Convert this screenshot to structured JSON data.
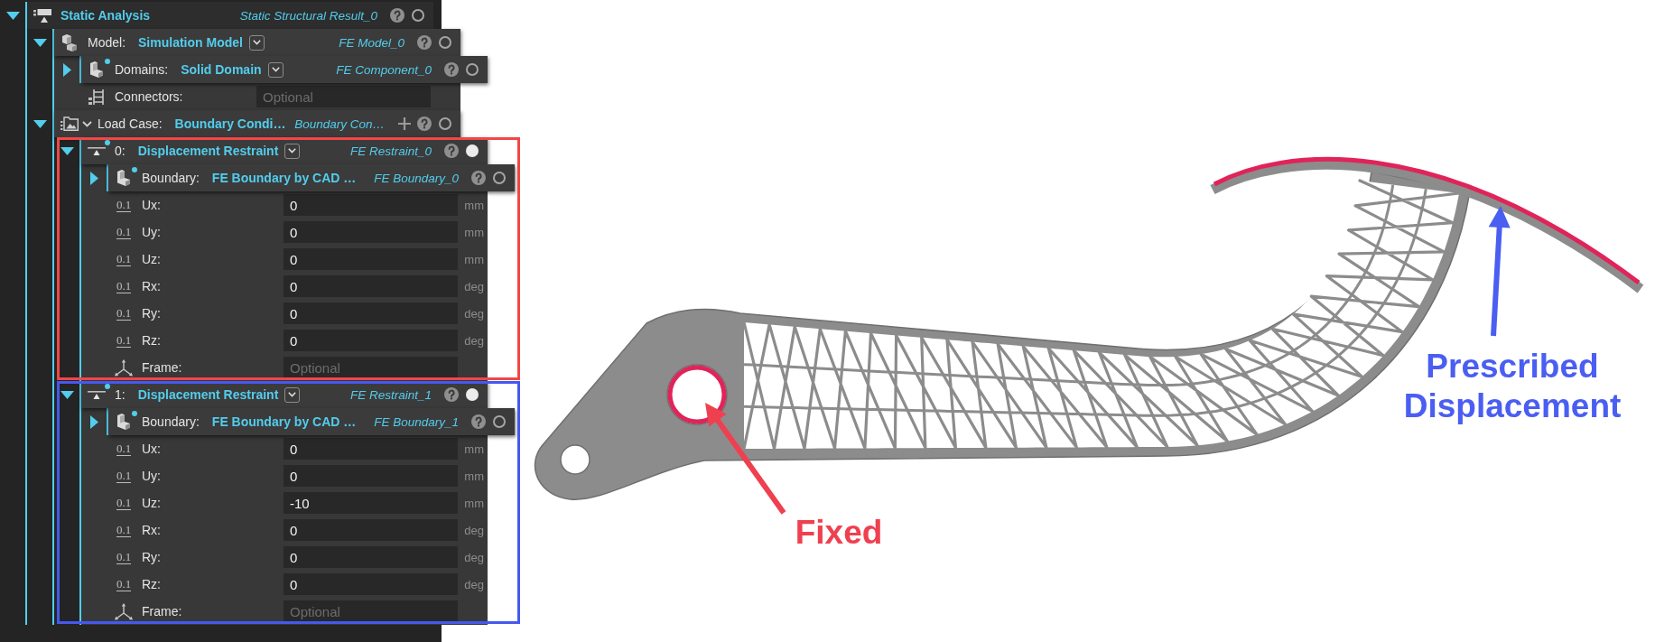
{
  "tree": [
    {
      "kind": "analysis",
      "value": "Static Analysis",
      "dropdown": false,
      "flagged": false,
      "addable": false,
      "type_name": "Static Structural Result_0",
      "expanded": true,
      "active": false,
      "children": [
        {
          "kind": "model",
          "label": "Model:",
          "value": "Simulation Model",
          "dropdown": true,
          "flagged": false,
          "addable": false,
          "type_name": "FE Model_0",
          "expanded": true,
          "active": false,
          "children": [
            {
              "kind": "domain",
              "label": "Domains:",
              "value": "Solid Domain",
              "dropdown": true,
              "flagged": true,
              "addable": false,
              "type_name": "FE Component_0",
              "expanded": false,
              "active": false
            },
            {
              "kind": "connectors",
              "label": "Connectors:",
              "placeholder": "Optional"
            }
          ]
        },
        {
          "kind": "load_case",
          "label": "Load Case:",
          "value": "Boundary Condi…",
          "dropdown": false,
          "flagged": false,
          "addable": true,
          "type_name": "Boundary Con…",
          "expanded": true,
          "active": false,
          "children": [
            {
              "kind": "restraint",
              "label": "0:",
              "value": "Displacement Restraint",
              "dropdown": true,
              "flagged": true,
              "addable": false,
              "type_name": "FE Restraint_0",
              "expanded": true,
              "active": true,
              "color": "#f24646",
              "children": [
                {
                  "kind": "boundary",
                  "label": "Boundary:",
                  "value": "FE Boundary by CAD …",
                  "dropdown": false,
                  "flagged": true,
                  "addable": false,
                  "type_name": "FE Boundary_0",
                  "expanded": false,
                  "active": false
                },
                {
                  "kind": "number",
                  "glyph": "0.1",
                  "label": "Ux:",
                  "value": "0",
                  "unit": "mm"
                },
                {
                  "kind": "number",
                  "glyph": "0.1",
                  "label": "Uy:",
                  "value": "0",
                  "unit": "mm"
                },
                {
                  "kind": "number",
                  "glyph": "0.1",
                  "label": "Uz:",
                  "value": "0",
                  "unit": "mm"
                },
                {
                  "kind": "number",
                  "glyph": "0.1",
                  "label": "Rx:",
                  "value": "0",
                  "unit": "deg"
                },
                {
                  "kind": "number",
                  "glyph": "0.1",
                  "label": "Ry:",
                  "value": "0",
                  "unit": "deg"
                },
                {
                  "kind": "number",
                  "glyph": "0.1",
                  "label": "Rz:",
                  "value": "0",
                  "unit": "deg"
                },
                {
                  "kind": "frame",
                  "label": "Frame:",
                  "placeholder": "Optional"
                }
              ]
            },
            {
              "kind": "restraint",
              "label": "1:",
              "value": "Displacement Restraint",
              "dropdown": true,
              "flagged": true,
              "addable": false,
              "type_name": "FE Restraint_1",
              "expanded": true,
              "active": true,
              "color": "#4558f0",
              "children": [
                {
                  "kind": "boundary",
                  "label": "Boundary:",
                  "value": "FE Boundary by CAD …",
                  "dropdown": false,
                  "flagged": true,
                  "addable": false,
                  "type_name": "FE Boundary_1",
                  "expanded": false,
                  "active": false
                },
                {
                  "kind": "number",
                  "glyph": "0.1",
                  "label": "Ux:",
                  "value": "0",
                  "unit": "mm"
                },
                {
                  "kind": "number",
                  "glyph": "0.1",
                  "label": "Uy:",
                  "value": "0",
                  "unit": "mm"
                },
                {
                  "kind": "number",
                  "glyph": "0.1",
                  "label": "Uz:",
                  "value": "-10",
                  "unit": "mm"
                },
                {
                  "kind": "number",
                  "glyph": "0.1",
                  "label": "Rx:",
                  "value": "0",
                  "unit": "deg"
                },
                {
                  "kind": "number",
                  "glyph": "0.1",
                  "label": "Ry:",
                  "value": "0",
                  "unit": "deg"
                },
                {
                  "kind": "number",
                  "glyph": "0.1",
                  "label": "Rz:",
                  "value": "0",
                  "unit": "deg"
                },
                {
                  "kind": "frame",
                  "label": "Frame:",
                  "placeholder": "Optional"
                }
              ]
            }
          ]
        }
      ]
    }
  ],
  "annotations": [
    {
      "text": "Fixed",
      "color": "#ef4050"
    },
    {
      "text": "Prescribed Displacement",
      "color": "#4a5ef2"
    }
  ]
}
